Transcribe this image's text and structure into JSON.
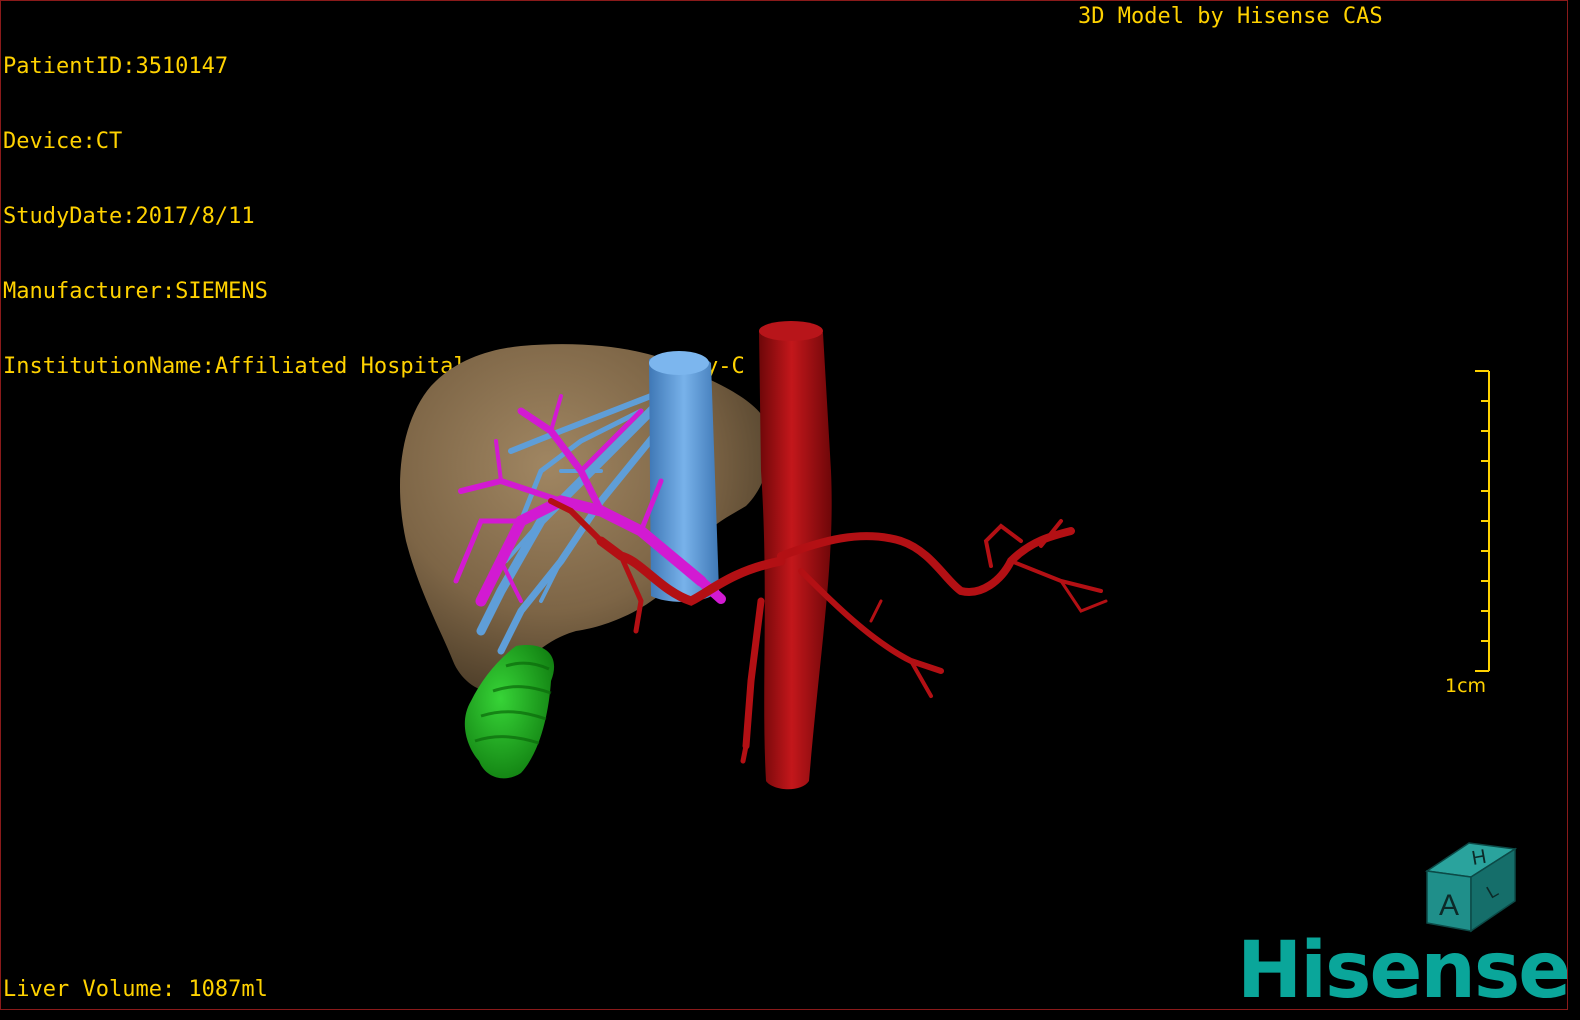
{
  "dicom": {
    "patient_id": "PatientID:3510147",
    "device": "Device:CT",
    "study_date": "StudyDate:2017/8/11",
    "manufacturer": "Manufacturer:SIEMENS",
    "institution": "InstitutionName:Affiliated Hospital Qingdao University-C"
  },
  "credit": "3D Model by Hisense CAS",
  "liver_volume": "Liver Volume: 1087ml",
  "scale_bar": {
    "label": "1cm",
    "ticks": 10
  },
  "orientation_cube": {
    "top_label": "H",
    "front_label": "A",
    "side_label": "L",
    "color": "#1f8f8a"
  },
  "brand": {
    "name": "Hisense",
    "color": "#0aa69a"
  },
  "colors": {
    "text": "#ffd200",
    "liver": "#8a7250",
    "portal_vein": "#d21ad2",
    "hepatic_vein": "#5f9ed8",
    "artery": "#b31014",
    "gallbladder": "#1fae1f",
    "border": "#8a1a1a"
  }
}
